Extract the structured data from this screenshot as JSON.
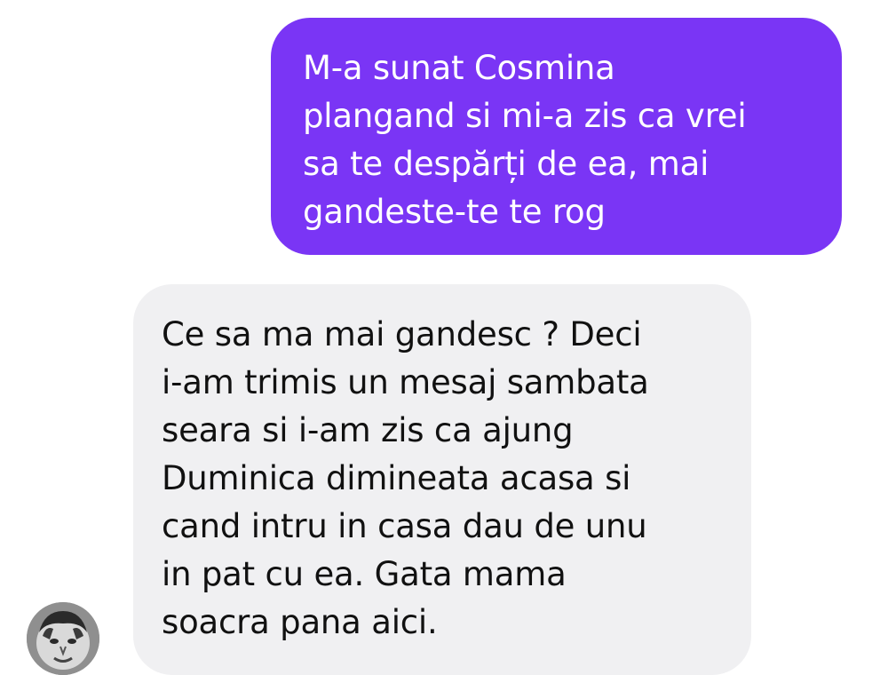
{
  "colors": {
    "sent_bubble": "#7a35f5",
    "received_bubble": "#f0f0f2",
    "sent_text": "#ffffff",
    "received_text": "#111111"
  },
  "messages": [
    {
      "direction": "sent",
      "lines": [
        "M-a sunat Cosmina",
        "plangand si mi-a zis ca vrei",
        "sa te despărți de ea, mai",
        "gandeste-te te rog"
      ]
    },
    {
      "direction": "received",
      "lines": [
        "Ce sa ma mai gandesc ? Deci",
        "i-am trimis un mesaj sambata",
        "seara si i-am zis ca ajung",
        "Duminica dimineata acasa si",
        "cand intru in casa dau de unu",
        "in pat cu ea. Gata mama",
        "soacra pana aici."
      ]
    }
  ],
  "contact": {
    "avatar_icon": "profile-photo-avatar"
  }
}
